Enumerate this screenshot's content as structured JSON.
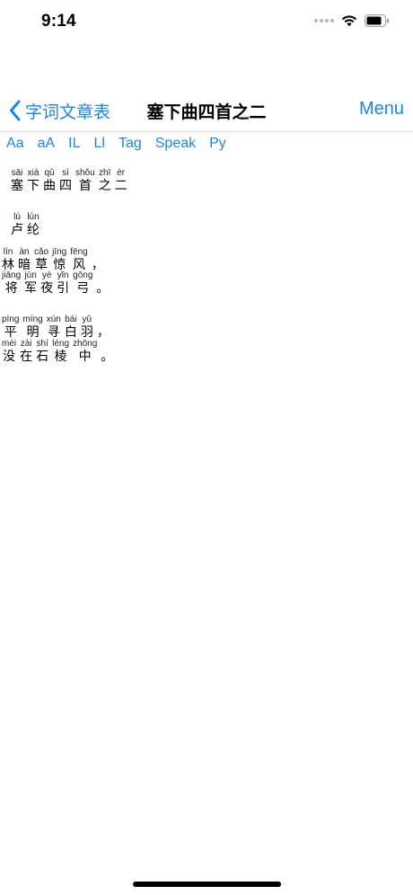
{
  "status_bar": {
    "time": "9:14"
  },
  "nav": {
    "back_label": "字词文章表",
    "title": "塞下曲四首之二",
    "menu_label": "Menu"
  },
  "toolbar": {
    "items": [
      "Aa",
      "aA",
      "IL",
      "Ll",
      "Tag",
      "Speak",
      "Py"
    ]
  },
  "poem": {
    "title_line": [
      {
        "py": "sāi",
        "hz": "塞"
      },
      {
        "py": "xià",
        "hz": "下"
      },
      {
        "py": "qǔ",
        "hz": "曲"
      },
      {
        "py": "sì",
        "hz": "四"
      },
      {
        "py": "shǒu",
        "hz": "首"
      },
      {
        "py": "zhī",
        "hz": "之"
      },
      {
        "py": "èr",
        "hz": "二"
      }
    ],
    "author_line": [
      {
        "py": "lú",
        "hz": "卢"
      },
      {
        "py": "lún",
        "hz": "纶"
      }
    ],
    "line1": [
      {
        "py": "lín",
        "hz": "林"
      },
      {
        "py": "àn",
        "hz": "暗"
      },
      {
        "py": "cǎo",
        "hz": "草"
      },
      {
        "py": "jīng",
        "hz": "惊"
      },
      {
        "py": "fēng",
        "hz": "风"
      },
      {
        "py": "",
        "hz": "，"
      }
    ],
    "line2": [
      {
        "py": "jiāng",
        "hz": "将"
      },
      {
        "py": "jūn",
        "hz": "军"
      },
      {
        "py": "yè",
        "hz": "夜"
      },
      {
        "py": "yǐn",
        "hz": "引"
      },
      {
        "py": "gōng",
        "hz": "弓"
      },
      {
        "py": "",
        "hz": "。"
      }
    ],
    "line3": [
      {
        "py": "píng",
        "hz": "平"
      },
      {
        "py": "míng",
        "hz": "明"
      },
      {
        "py": "xún",
        "hz": "寻"
      },
      {
        "py": "bái",
        "hz": "白"
      },
      {
        "py": "yǔ",
        "hz": "羽"
      },
      {
        "py": "",
        "hz": "，"
      }
    ],
    "line4": [
      {
        "py": "méi",
        "hz": "没"
      },
      {
        "py": "zài",
        "hz": "在"
      },
      {
        "py": "shí",
        "hz": "石"
      },
      {
        "py": "léng",
        "hz": "棱"
      },
      {
        "py": "zhōng",
        "hz": "中"
      },
      {
        "py": "",
        "hz": "。"
      }
    ]
  }
}
